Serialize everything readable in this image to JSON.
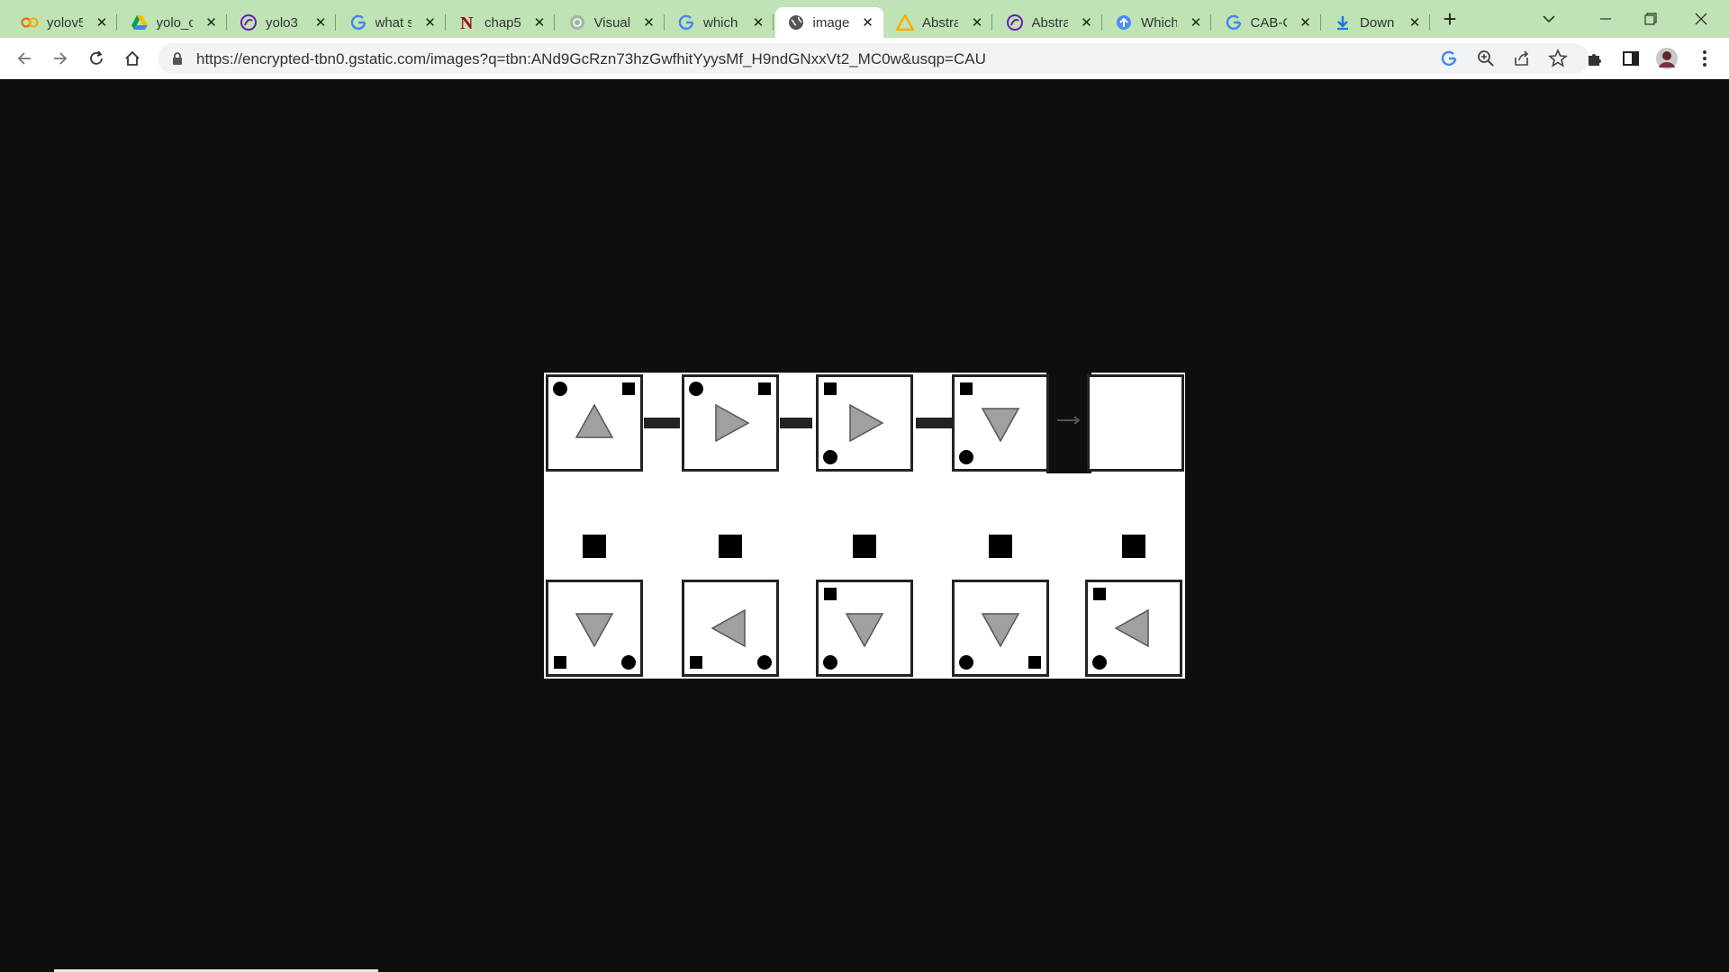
{
  "browser": {
    "tabs": [
      {
        "title": "yolov5",
        "icon": "colab-icon"
      },
      {
        "title": "yolo_c",
        "icon": "google-drive-icon"
      },
      {
        "title": "yolo3",
        "icon": "site-icon"
      },
      {
        "title": "what s",
        "icon": "google-icon"
      },
      {
        "title": "chap5",
        "icon": "n-logo-icon"
      },
      {
        "title": "Visual",
        "icon": "openai-icon"
      },
      {
        "title": "which",
        "icon": "google-icon"
      },
      {
        "title": "image",
        "icon": "globe-icon",
        "active": true
      },
      {
        "title": "Abstra",
        "icon": "warning-icon"
      },
      {
        "title": "Abstra",
        "icon": "site-icon"
      },
      {
        "title": "Which",
        "icon": "upload-icon"
      },
      {
        "title": "CAB-C",
        "icon": "google-icon"
      },
      {
        "title": "Down",
        "icon": "download-icon"
      }
    ],
    "url": "https://encrypted-tbn0.gstatic.com/images?q=tbn:ANd9GcRzn73hzGwfhitYyysMf_H9ndGNxxVt2_MC0w&usqp=CAU",
    "colors": {
      "tabbar": "#bfe3b4",
      "page_bg": "#0e0e0e",
      "accent": "#1a73e8"
    }
  },
  "puzzle": {
    "sequence_cells": [
      {
        "arrow": "up",
        "markers": {
          "top-left": "circle",
          "top-right": "square"
        }
      },
      {
        "arrow": "right",
        "markers": {
          "top-left": "circle",
          "top-right": "square"
        }
      },
      {
        "arrow": "right",
        "markers": {
          "top-left": "square",
          "bottom-left": "circle"
        }
      },
      {
        "arrow": "down",
        "markers": {
          "top-left": "square",
          "bottom-left": "circle"
        }
      },
      {
        "arrow": "none",
        "markers": {}
      }
    ],
    "options": [
      {
        "arrow": "down",
        "markers": {
          "bottom-left": "square",
          "bottom-right": "circle"
        }
      },
      {
        "arrow": "left",
        "markers": {
          "bottom-left": "square",
          "bottom-right": "circle"
        }
      },
      {
        "arrow": "down",
        "markers": {
          "top-left": "square",
          "bottom-left": "circle"
        }
      },
      {
        "arrow": "down",
        "markers": {
          "bottom-left": "circle",
          "bottom-right": "square"
        }
      },
      {
        "arrow": "left",
        "markers": {
          "top-left": "square",
          "bottom-left": "circle"
        }
      }
    ]
  }
}
